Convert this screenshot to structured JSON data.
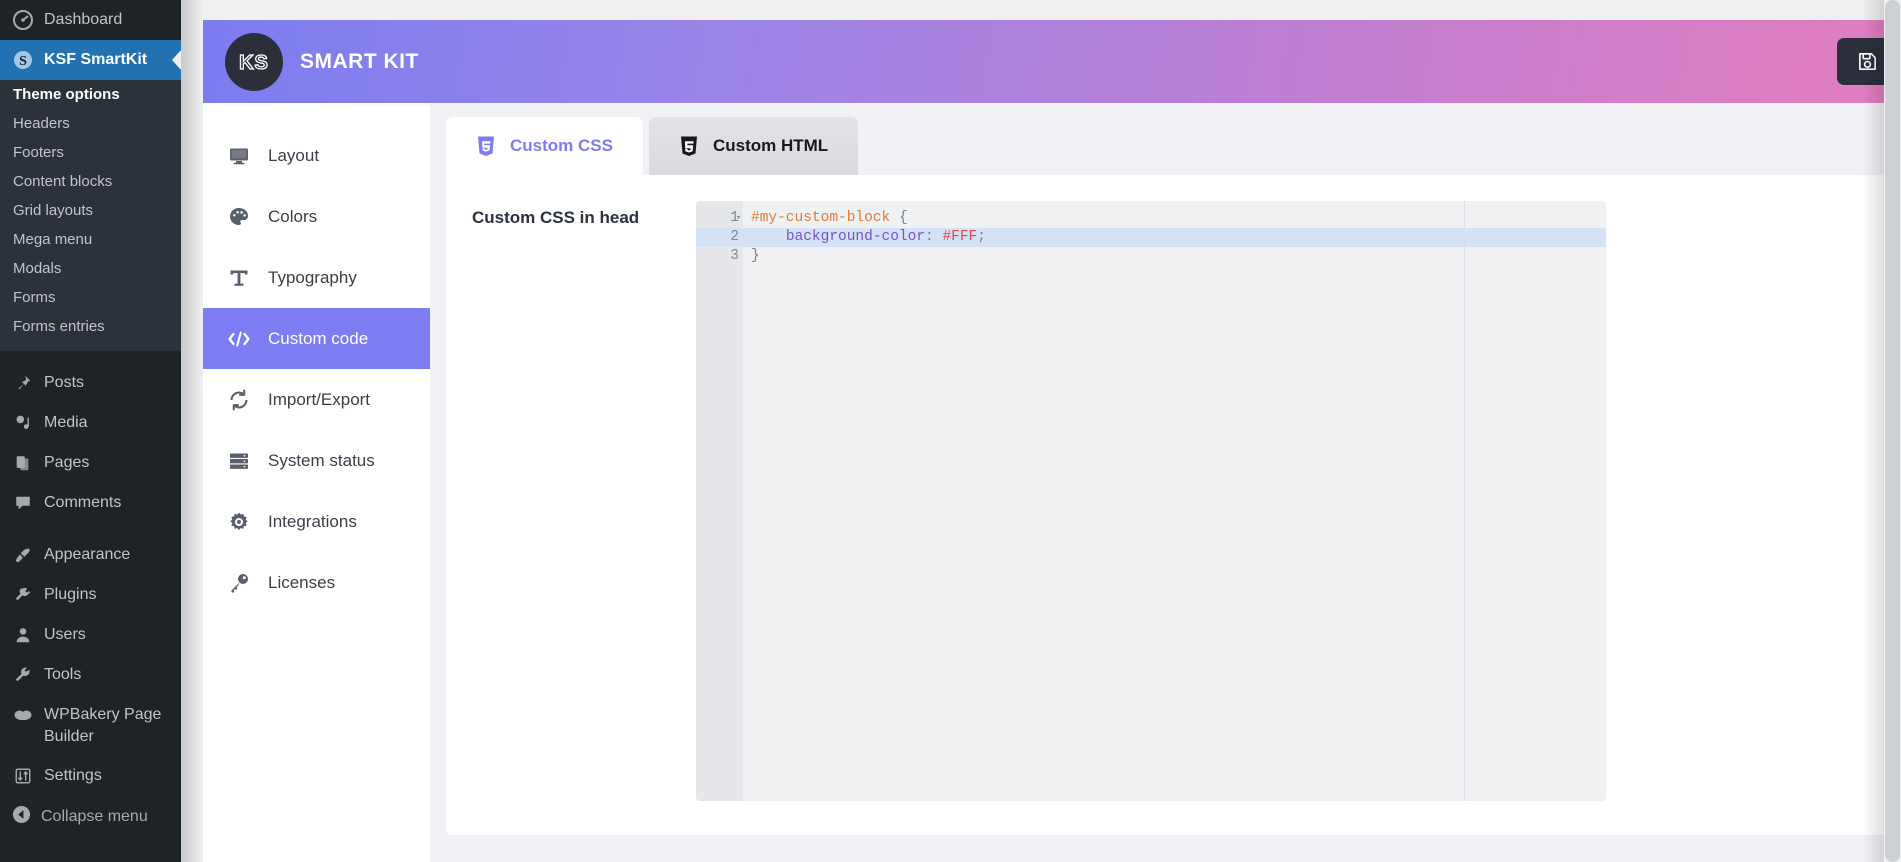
{
  "wp_sidebar": {
    "items": [
      {
        "label": "Dashboard",
        "icon": "dashboard-icon",
        "active": false
      },
      {
        "label": "KSF SmartKit",
        "icon": "smartkit-icon",
        "active": true
      }
    ],
    "submenu": {
      "current": "Theme options",
      "items": [
        "Theme options",
        "Headers",
        "Footers",
        "Content blocks",
        "Grid layouts",
        "Mega menu",
        "Modals",
        "Forms",
        "Forms entries"
      ]
    },
    "group_two": [
      {
        "label": "Posts",
        "icon": "pin-icon"
      },
      {
        "label": "Media",
        "icon": "media-icon"
      },
      {
        "label": "Pages",
        "icon": "pages-icon"
      },
      {
        "label": "Comments",
        "icon": "comment-icon"
      }
    ],
    "group_three": [
      {
        "label": "Appearance",
        "icon": "brush-icon"
      },
      {
        "label": "Plugins",
        "icon": "plug-icon"
      },
      {
        "label": "Users",
        "icon": "user-icon"
      },
      {
        "label": "Tools",
        "icon": "wrench-icon"
      },
      {
        "label": "WPBakery Page Builder",
        "icon": "wpbakery-icon"
      },
      {
        "label": "Settings",
        "icon": "sliders-icon"
      }
    ],
    "collapse": {
      "label": "Collapse menu",
      "icon": "collapse-arrow-icon"
    }
  },
  "header": {
    "brand_mark": "KS",
    "title": "SMART KIT",
    "save_label": "Save settings",
    "save_icon": "floppy-save-icon",
    "gradient_start": "#7b7cf0",
    "gradient_end": "#ec7ebc",
    "save_bg": "#2b303c"
  },
  "plugin_nav": {
    "items": [
      {
        "label": "Layout",
        "icon": "monitor-icon",
        "active": false
      },
      {
        "label": "Colors",
        "icon": "palette-icon",
        "active": false
      },
      {
        "label": "Typography",
        "icon": "type-t-icon",
        "active": false
      },
      {
        "label": "Custom code",
        "icon": "code-brackets-icon",
        "active": true
      },
      {
        "label": "Import/Export",
        "icon": "sync-arrows-icon",
        "active": false
      },
      {
        "label": "System status",
        "icon": "server-icon",
        "active": false
      },
      {
        "label": "Integrations",
        "icon": "gear-icon",
        "active": false
      },
      {
        "label": "Licenses",
        "icon": "key-icon",
        "active": false
      }
    ],
    "active_bg": "#7c7df2"
  },
  "tabs": [
    {
      "label": "Custom CSS",
      "icon": "css3-shield-icon",
      "active": true
    },
    {
      "label": "Custom HTML",
      "icon": "html5-shield-icon",
      "active": false
    }
  ],
  "panel": {
    "field_label": "Custom CSS in head",
    "reset_icon": "rotate-ccw-reset-icon",
    "editor": {
      "active_line": 2,
      "lines": [
        {
          "num": "1",
          "foldable": true,
          "highlight": false,
          "tokens": [
            {
              "text": "#my-custom-block",
              "type": "selector"
            },
            {
              "text": " ",
              "type": "plain"
            },
            {
              "text": "{",
              "type": "punctuation"
            }
          ]
        },
        {
          "num": "2",
          "foldable": false,
          "highlight": true,
          "tokens": [
            {
              "text": "    ",
              "type": "plain"
            },
            {
              "text": "background-color",
              "type": "property"
            },
            {
              "text": ": ",
              "type": "punctuation"
            },
            {
              "text": "#FFF",
              "type": "value"
            },
            {
              "text": ";",
              "type": "punctuation"
            }
          ]
        },
        {
          "num": "3",
          "foldable": false,
          "highlight": false,
          "tokens": [
            {
              "text": "}",
              "type": "punctuation"
            }
          ]
        }
      ]
    }
  }
}
